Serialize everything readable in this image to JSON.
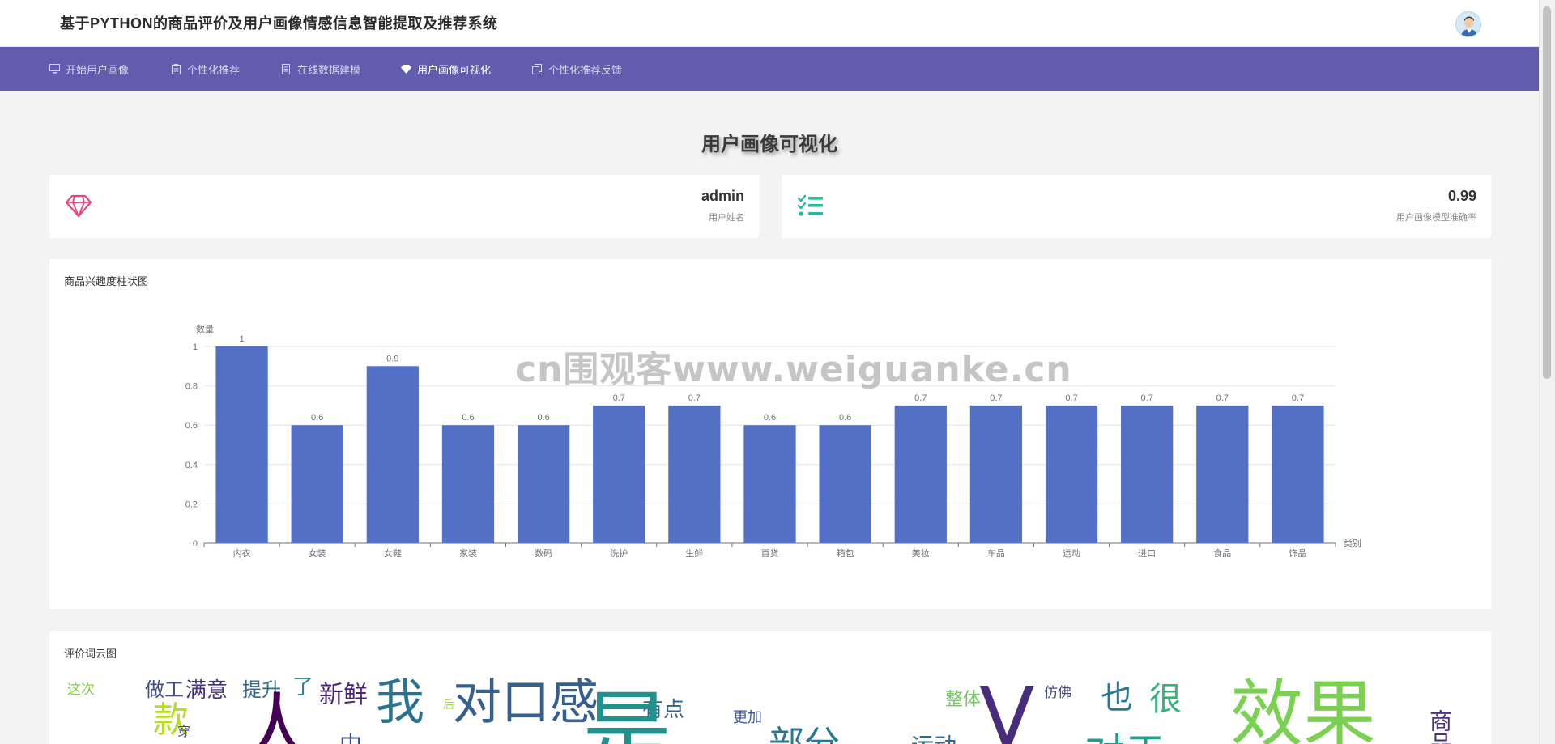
{
  "app": {
    "title": "基于PYTHON的商品评价及用户画像情感信息智能提取及推荐系统"
  },
  "nav": {
    "items": [
      {
        "label": "开始用户画像",
        "icon": "monitor-icon"
      },
      {
        "label": "个性化推荐",
        "icon": "clipboard-icon"
      },
      {
        "label": "在线数据建模",
        "icon": "document-icon"
      },
      {
        "label": "用户画像可视化",
        "icon": "diamond-icon",
        "active": true
      },
      {
        "label": "个性化推荐反馈",
        "icon": "copy-icon"
      }
    ]
  },
  "page": {
    "title": "用户画像可视化"
  },
  "stats": {
    "username": {
      "value": "admin",
      "label": "用户姓名",
      "icon": "diamond-icon",
      "color": "#e8467c"
    },
    "accuracy": {
      "value": "0.99",
      "label": "用户画像模型准确率",
      "icon": "checklist-icon",
      "color": "#26b99a"
    }
  },
  "interest_chart": {
    "card_title": "商品兴趣度柱状图"
  },
  "chart_data": {
    "type": "bar",
    "title": "",
    "xlabel": "类别",
    "ylabel": "数量",
    "categories": [
      "内衣",
      "女装",
      "女鞋",
      "家装",
      "数码",
      "洗护",
      "生鲜",
      "百货",
      "箱包",
      "美妆",
      "车品",
      "运动",
      "进口",
      "食品",
      "饰品"
    ],
    "values": [
      1,
      0.6,
      0.9,
      0.6,
      0.6,
      0.7,
      0.7,
      0.6,
      0.6,
      0.7,
      0.7,
      0.7,
      0.7,
      0.7,
      0.7
    ],
    "data_labels": [
      "1",
      "0.6",
      "0.9",
      "0.6",
      "0.6",
      "0.7",
      "0.7",
      "0.6",
      "0.6",
      "0.7",
      "0.7",
      "0.7",
      "0.7",
      "0.7",
      "0.7"
    ],
    "ylim": [
      0,
      1
    ],
    "yticks": [
      "0",
      "0.2",
      "0.4",
      "0.6",
      "0.8",
      "1"
    ],
    "grid": true,
    "bar_color": "#5470c6"
  },
  "wordcloud": {
    "card_title": "评价词云图",
    "words": [
      {
        "text": "这次",
        "color": "#86c94a"
      },
      {
        "text": "做工",
        "color": "#3e4a89"
      },
      {
        "text": "满意",
        "color": "#46337e"
      },
      {
        "text": "提升",
        "color": "#31688e"
      },
      {
        "text": "了",
        "color": "#26828e"
      },
      {
        "text": "新鲜",
        "color": "#482475"
      },
      {
        "text": "我",
        "color": "#2c728e"
      },
      {
        "text": "对口感",
        "color": "#355f8d"
      },
      {
        "text": "有点",
        "color": "#33638d"
      },
      {
        "text": "更加",
        "color": "#39568c"
      },
      {
        "text": "整体",
        "color": "#6ccd5a"
      },
      {
        "text": "仿佛",
        "color": "#414487"
      },
      {
        "text": "也",
        "color": "#2a788e"
      },
      {
        "text": "很",
        "color": "#35b779"
      },
      {
        "text": "效果",
        "color": "#7ad151"
      },
      {
        "text": "中",
        "color": "#3b528b"
      },
      {
        "text": "部分",
        "color": "#2a788e"
      },
      {
        "text": "运动",
        "color": "#31688e"
      },
      {
        "text": "对于",
        "color": "#1f9e89"
      },
      {
        "text": "款",
        "color": "#b5de2b"
      },
      {
        "text": "人",
        "color": "#440154"
      },
      {
        "text": "V",
        "color": "#472d7b"
      },
      {
        "text": "后",
        "color": "#a0da39"
      },
      {
        "text": "穿",
        "color": "#3e4a89"
      },
      {
        "text": "是",
        "color": "#21918c"
      },
      {
        "text": "商品",
        "color": "#46327e"
      }
    ]
  },
  "watermark": {
    "text": "cn围观客www.weiguanke.cn"
  }
}
